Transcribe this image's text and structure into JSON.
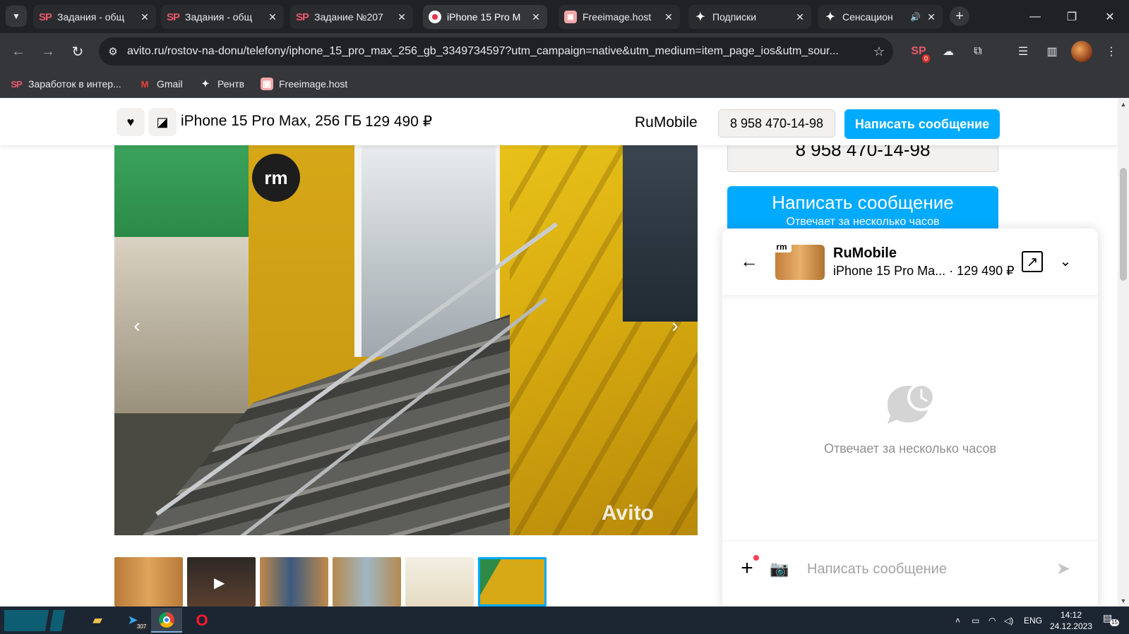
{
  "browser": {
    "tabs": [
      {
        "title": "Задания - общ",
        "favicon": "sp-logo-icon",
        "active": false
      },
      {
        "title": "Задания - общ",
        "favicon": "sp-logo-icon",
        "active": false
      },
      {
        "title": "Задание №207",
        "favicon": "sp-logo-icon",
        "active": false
      },
      {
        "title": "iPhone 15 Pro M",
        "favicon": "record-icon",
        "active": true
      },
      {
        "title": "Freeimage.host",
        "favicon": "freeimage-icon",
        "active": false
      },
      {
        "title": "Подписки",
        "favicon": "sparkle-icon",
        "active": false
      },
      {
        "title": "Сенсацион",
        "favicon": "sparkle-icon",
        "active": false,
        "audio": true
      }
    ],
    "address": {
      "url": "avito.ru/rostov-na-donu/telefony/iphone_15_pro_max_256_gb_3349734597?utm_campaign=native&utm_medium=item_page_ios&utm_sour..."
    },
    "extensions": {
      "sp_badge": "0"
    },
    "bookmarks": [
      {
        "label": "Заработок в интер...",
        "icon": "sp-logo-icon"
      },
      {
        "label": "Gmail",
        "icon": "gmail-icon"
      },
      {
        "label": "Рентв",
        "icon": "sparkle-icon"
      },
      {
        "label": "Freeimage.host",
        "icon": "freeimage-icon"
      }
    ]
  },
  "sticky_header": {
    "title": "iPhone 15 Pro Max, 256 ГБ",
    "price": "129 490 ₽",
    "seller": "RuMobile",
    "phone": "8 958 470-14-98",
    "message_button": "Написать сообщение"
  },
  "gallery": {
    "watermark": "Avito",
    "thumbnails_count": 6,
    "selected_thumbnail": 6
  },
  "contact_panel": {
    "phone": "8 958 470-14-98",
    "message_button": "Написать сообщение",
    "response_time": "Отвечает за несколько часов"
  },
  "chat": {
    "seller_name": "RuMobile",
    "item_title": "iPhone 15 Pro Ma...",
    "item_price": "· 129 490 ₽",
    "empty_state": "Отвечает за несколько часов",
    "input_placeholder": "Написать сообщение"
  },
  "taskbar": {
    "telegram_badge": "307",
    "language": "ENG",
    "time": "14:12",
    "date": "24.12.2023",
    "notifications": "15"
  },
  "colors": {
    "accent": "#00aaff",
    "chrome_dark": "#202124",
    "chrome_toolbar": "#35363a",
    "taskbar": "#1c2633"
  }
}
